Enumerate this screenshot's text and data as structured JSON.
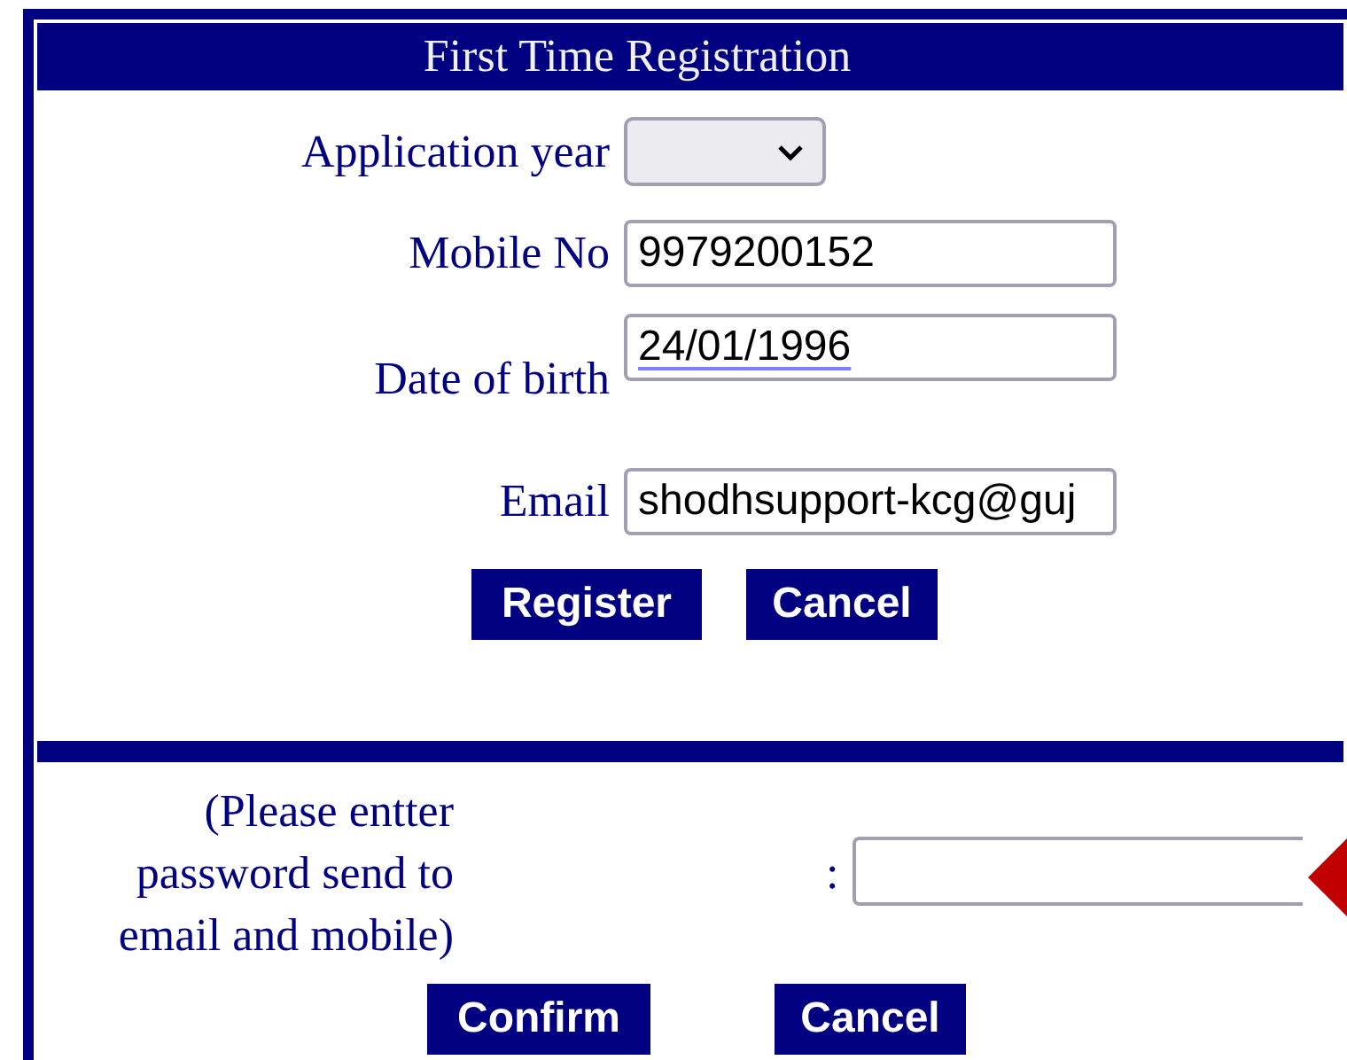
{
  "title": "First Time Registration",
  "fields": [
    {
      "kind": "select",
      "label": "Application year"
    },
    {
      "kind": "text",
      "label": "Mobile No",
      "value": "9979200152"
    },
    {
      "kind": "date",
      "label": "Date of birth",
      "value": "24/01/1996"
    },
    {
      "kind": "text",
      "label": "Email",
      "value": "shodhsupport-kcg@guj"
    }
  ],
  "buttons": [
    "Register",
    "Cancel"
  ],
  "password": {
    "note": "(Please entter password send to email and mobile)",
    "separator": ":"
  },
  "confirm_buttons": [
    "Confirm",
    "Cancel"
  ]
}
